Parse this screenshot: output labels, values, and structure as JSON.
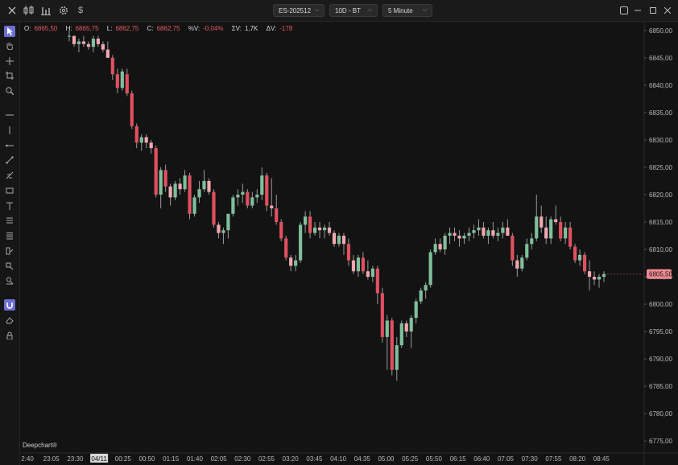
{
  "topbar": {
    "symbol": "ES-202512",
    "range": "10D - BT",
    "interval": "5 Minute"
  },
  "info": {
    "o_label": "O:",
    "o": "6865,50",
    "h_label": "H:",
    "h": "6865,75",
    "l_label": "L:",
    "l": "6862,75",
    "c_label": "C:",
    "c": "6862,75",
    "pct_label": "%V:",
    "pct": "-0,04%",
    "sv_label": "ΣV:",
    "sv": "1,7K",
    "dv_label": "ΔV:",
    "dv": "-178"
  },
  "brand": "Deepchart®",
  "colors": {
    "background": "#131313",
    "up": "#7fbf9c",
    "down": "#e05060",
    "down_light": "#f1a7ae",
    "price_tag": "#f08a92"
  },
  "icons": {
    "topbar": [
      "close-icon",
      "bar-style-icon",
      "chart-type-icon",
      "settings-gear-icon",
      "dollar-icon"
    ],
    "window": [
      "maximize-icon",
      "minimize-icon",
      "restore-icon",
      "close-window-icon"
    ],
    "tools": [
      "cursor-icon",
      "hand-icon",
      "crosshair-icon",
      "crop-icon",
      "zoom-icon",
      "horizontal-line-icon",
      "vertical-line-icon",
      "ray-icon",
      "trend-line-icon",
      "fib-icon",
      "rectangle-icon",
      "text-icon",
      "list-icon",
      "lines-icon",
      "brush-icon",
      "ruler-icon",
      "marker-icon",
      "magnet-icon",
      "eraser-icon",
      "lock-icon"
    ]
  },
  "chart_data": {
    "type": "candlestick",
    "ylim": [
      6774,
      6851
    ],
    "y_ticks": [
      "6850,00",
      "6845,00",
      "6840,00",
      "6835,00",
      "6830,00",
      "6825,00",
      "6820,00",
      "6815,00",
      "6810,00",
      "6805,00",
      "6800,00",
      "6795,00",
      "6790,00",
      "6785,00",
      "6780,00",
      "6775,00"
    ],
    "x_ticks": [
      "2:40",
      "23:05",
      "23:30",
      "04/11",
      "00:25",
      "00:50",
      "01:15",
      "01:40",
      "02:05",
      "02:30",
      "02:55",
      "03:20",
      "03:45",
      "04:10",
      "04:35",
      "05:00",
      "05:25",
      "05:50",
      "06:15",
      "06:40",
      "07:05",
      "07:30",
      "07:55",
      "08:20",
      "08:45"
    ],
    "x_tick_highlight": "04/11",
    "last_price": "6805,50",
    "last_value": 6805.5,
    "candles": [
      [
        6849,
        6850,
        6848,
        6849
      ],
      [
        6849,
        6849,
        6847,
        6847.5
      ],
      [
        6847.5,
        6848.5,
        6846,
        6848
      ],
      [
        6848,
        6849,
        6847,
        6847.5
      ],
      [
        6847.5,
        6848,
        6846.5,
        6847
      ],
      [
        6847,
        6849,
        6846,
        6848.5
      ],
      [
        6848.5,
        6849,
        6847,
        6847.5
      ],
      [
        6847.5,
        6848,
        6846,
        6846.5
      ],
      [
        6846.5,
        6848,
        6845,
        6845
      ],
      [
        6845,
        6845.5,
        6841,
        6842
      ],
      [
        6842,
        6843,
        6838.5,
        6839.5
      ],
      [
        6839.5,
        6843,
        6839,
        6842.5
      ],
      [
        6842,
        6843,
        6838,
        6838.5
      ],
      [
        6838.5,
        6839,
        6832,
        6832.5
      ],
      [
        6832.5,
        6833,
        6828.5,
        6829.5
      ],
      [
        6829.5,
        6831,
        6828,
        6830.5
      ],
      [
        6830.5,
        6831,
        6828.5,
        6829.5
      ],
      [
        6829.5,
        6830,
        6827.5,
        6828.5
      ],
      [
        6828.5,
        6829,
        6819.5,
        6820
      ],
      [
        6820,
        6825,
        6817.5,
        6824.5
      ],
      [
        6824.5,
        6825.5,
        6820.5,
        6821.5
      ],
      [
        6821.5,
        6822,
        6818,
        6819.5
      ],
      [
        6819.5,
        6822.5,
        6819,
        6822
      ],
      [
        6822,
        6823,
        6820,
        6821
      ],
      [
        6821,
        6824.5,
        6820.5,
        6823.5
      ],
      [
        6823.5,
        6824,
        6815.5,
        6816.5
      ],
      [
        6816.5,
        6820,
        6816,
        6819.5
      ],
      [
        6819.5,
        6822.5,
        6818.5,
        6821
      ],
      [
        6821,
        6824.5,
        6820.5,
        6822.5
      ],
      [
        6822.5,
        6823,
        6820,
        6820.5
      ],
      [
        6820.5,
        6821,
        6814,
        6814.5
      ],
      [
        6814.5,
        6815,
        6812,
        6813
      ],
      [
        6813,
        6814,
        6811,
        6813.5
      ],
      [
        6813.5,
        6815,
        6812,
        6816.5
      ],
      [
        6816.5,
        6820,
        6816,
        6819.5
      ],
      [
        6819.5,
        6821,
        6818,
        6820
      ],
      [
        6820,
        6822,
        6818.5,
        6820.5
      ],
      [
        6820.5,
        6821,
        6817.5,
        6818
      ],
      [
        6818,
        6820.5,
        6817.5,
        6819.5
      ],
      [
        6819.5,
        6821,
        6818.5,
        6820
      ],
      [
        6820,
        6825,
        6819,
        6823.5
      ],
      [
        6823.5,
        6824,
        6817,
        6818
      ],
      [
        6818,
        6823,
        6816,
        6817.5
      ],
      [
        6817.5,
        6820,
        6814.5,
        6815
      ],
      [
        6815,
        6815.5,
        6811.5,
        6812
      ],
      [
        6812,
        6812.5,
        6808,
        6808.5
      ],
      [
        6808.5,
        6809,
        6806,
        6807
      ],
      [
        6807,
        6809,
        6806,
        6808
      ],
      [
        6808,
        6815,
        6807.5,
        6814.5
      ],
      [
        6814.5,
        6817,
        6813,
        6816
      ],
      [
        6816,
        6817,
        6812,
        6813
      ],
      [
        6813,
        6815,
        6812.5,
        6814
      ],
      [
        6814,
        6815,
        6812,
        6813.5
      ],
      [
        6813.5,
        6814.5,
        6812,
        6814
      ],
      [
        6814,
        6815,
        6812.5,
        6813
      ],
      [
        6813,
        6813.5,
        6810.5,
        6811
      ],
      [
        6811,
        6813,
        6810.5,
        6812.5
      ],
      [
        6812.5,
        6813,
        6809,
        6811
      ],
      [
        6811,
        6812,
        6807,
        6808
      ],
      [
        6808,
        6809,
        6805.5,
        6806
      ],
      [
        6806,
        6809,
        6805,
        6808.5
      ],
      [
        6808.5,
        6809.5,
        6805.5,
        6806
      ],
      [
        6806,
        6808,
        6804.5,
        6805
      ],
      [
        6805,
        6807,
        6804,
        6806.5
      ],
      [
        6806.5,
        6807,
        6800,
        6802
      ],
      [
        6802,
        6803,
        6793,
        6794
      ],
      [
        6794,
        6798,
        6788,
        6797
      ],
      [
        6797,
        6797.5,
        6787,
        6788
      ],
      [
        6788,
        6794,
        6786,
        6792.5
      ],
      [
        6792.5,
        6797,
        6792,
        6796.5
      ],
      [
        6796.5,
        6797,
        6794,
        6795
      ],
      [
        6795,
        6798,
        6792,
        6797.5
      ],
      [
        6797.5,
        6801,
        6796.5,
        6800.5
      ],
      [
        6800.5,
        6803,
        6800,
        6802.5
      ],
      [
        6802.5,
        6804,
        6801,
        6803.5
      ],
      [
        6803.5,
        6810,
        6803,
        6809.5
      ],
      [
        6809.5,
        6812,
        6809,
        6811
      ],
      [
        6811,
        6812,
        6809.5,
        6810
      ],
      [
        6810,
        6813,
        6809,
        6812.5
      ],
      [
        6812.5,
        6814,
        6811,
        6813
      ],
      [
        6813,
        6814,
        6811.5,
        6812.5
      ],
      [
        6812.5,
        6813.5,
        6810.5,
        6812
      ],
      [
        6812,
        6813,
        6811,
        6812.5
      ],
      [
        6812.5,
        6814,
        6811.5,
        6813
      ],
      [
        6813,
        6814.5,
        6812,
        6813.5
      ],
      [
        6813.5,
        6815.5,
        6812.5,
        6814
      ],
      [
        6814,
        6815,
        6812,
        6812.5
      ],
      [
        6812.5,
        6814,
        6811,
        6813.5
      ],
      [
        6813.5,
        6815,
        6812,
        6812.5
      ],
      [
        6812.5,
        6814,
        6811.5,
        6813
      ],
      [
        6813,
        6815,
        6812,
        6814
      ],
      [
        6814,
        6815.5,
        6812.5,
        6812.5
      ],
      [
        6812.5,
        6813,
        6807,
        6808
      ],
      [
        6808,
        6809,
        6805,
        6806.5
      ],
      [
        6806.5,
        6809,
        6806,
        6808.5
      ],
      [
        6808.5,
        6812,
        6808,
        6811
      ],
      [
        6811,
        6813,
        6810,
        6812
      ],
      [
        6812,
        6820,
        6811.5,
        6816
      ],
      [
        6816,
        6818,
        6813,
        6814
      ],
      [
        6814,
        6816,
        6811,
        6812
      ],
      [
        6812,
        6816,
        6811,
        6815.5
      ],
      [
        6815.5,
        6818,
        6814.5,
        6815
      ],
      [
        6815,
        6816,
        6811.5,
        6812
      ],
      [
        6812,
        6815,
        6811,
        6814
      ],
      [
        6814,
        6815,
        6810,
        6810.5
      ],
      [
        6810.5,
        6811,
        6807.5,
        6808
      ],
      [
        6808,
        6810,
        6807,
        6809
      ],
      [
        6809,
        6809.5,
        6805.5,
        6806
      ],
      [
        6806,
        6808,
        6802.5,
        6805
      ],
      [
        6805,
        6806,
        6803.5,
        6804.5
      ],
      [
        6804.5,
        6805.5,
        6803,
        6805
      ],
      [
        6805,
        6806,
        6804,
        6805.5
      ]
    ]
  }
}
